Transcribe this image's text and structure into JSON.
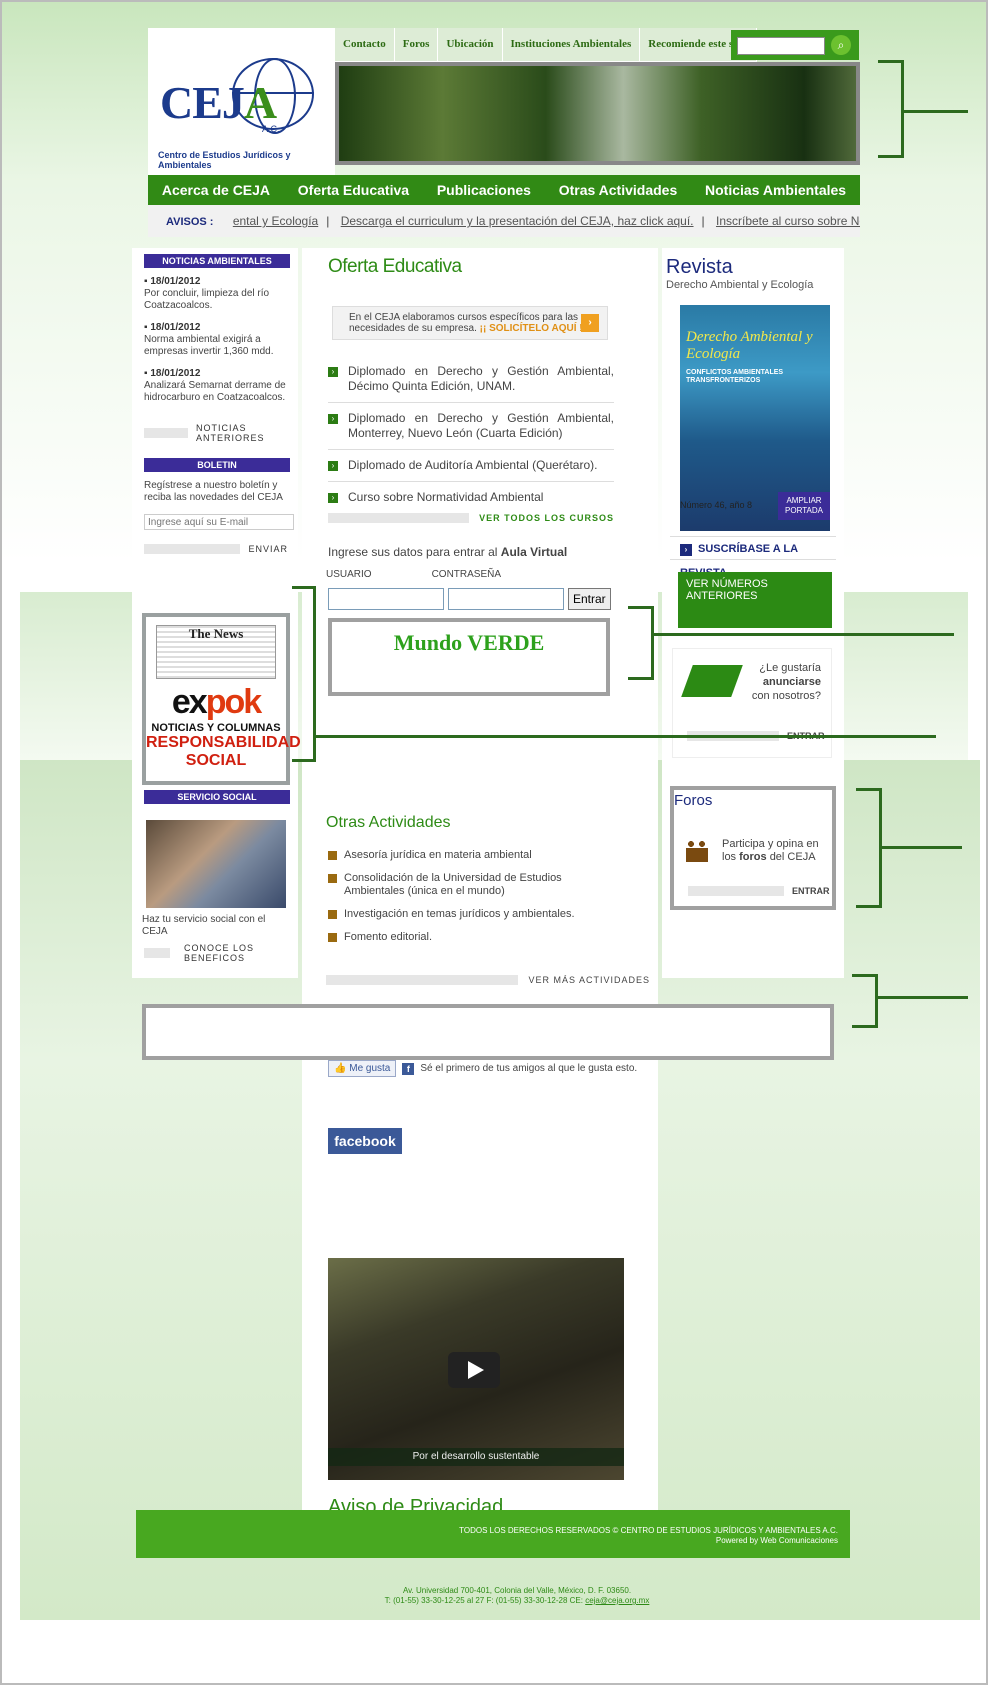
{
  "logo": {
    "name": "CEJA",
    "ac": "A.C.",
    "tagline": "Centro de Estudios Jurídicos y Ambientales"
  },
  "topnav": [
    "Contacto",
    "Foros",
    "Ubicación",
    "Instituciones Ambientales",
    "Recomiende este sitio"
  ],
  "search": {
    "value": "",
    "icon": "search-icon"
  },
  "mainnav": [
    "Acerca de CEJA",
    "Oferta Educativa",
    "Publicaciones",
    "Otras Actividades",
    "Noticias Ambientales"
  ],
  "avisos": {
    "label": "AVISOS :",
    "items": [
      "ental y Ecología",
      "Descarga el curriculum y la presentación del CEJA, haz click aquí.",
      "Inscríbete al curso sobre Norn"
    ],
    "sep": "|"
  },
  "left": {
    "news_header": "NOTICIAS AMBIENTALES",
    "news": [
      {
        "date": "18/01/2012",
        "text": "Por concluir, limpieza del río Coatzacoalcos."
      },
      {
        "date": "18/01/2012",
        "text": "Norma ambiental exigirá a empresas invertir 1,360 mdd."
      },
      {
        "date": "18/01/2012",
        "text": "Analizará Semarnat derrame de hidrocarburo en Coatzacoalcos."
      }
    ],
    "news_more": "NOTICIAS ANTERIORES",
    "boletin_header": "BOLETIN",
    "boletin_text": "Regístrese a nuestro boletín y reciba las novedades del CEJA",
    "email_placeholder": "Ingrese aquí su E-mail",
    "enviar": "ENVIAR",
    "expok": {
      "paper": "The News",
      "brand_a": "ex",
      "brand_b": "pok",
      "line1": "NOTICIAS Y COLUMNAS",
      "line2": "RESPONSABILIDAD SOCIAL"
    },
    "social_header": "SERVICIO SOCIAL",
    "social_text": "Haz tu servicio social con el CEJA",
    "social_more": "CONOCE LOS BENEFICOS"
  },
  "center": {
    "title": "Oferta Educativa",
    "promo_text": "En el CEJA elaboramos cursos específicos para las necesidades de su empresa.",
    "promo_cta": "¡¡ SOLICÍTELO AQUÍ !!",
    "courses": [
      "Diplomado en Derecho y Gestión Ambiental, Décimo Quinta Edición, UNAM.",
      "Diplomado en Derecho y Gestión Ambiental, Monterrey, Nuevo León (Cuarta Edición)",
      "Diplomado de Auditoría Ambiental (Querétaro).",
      "Curso sobre Normatividad Ambiental"
    ],
    "ver_cursos": "VER TODOS LOS CURSOS",
    "aula_text": "Ingrese sus datos para entrar al",
    "aula_bold": "Aula Virtual",
    "usuario": "USUARIO",
    "contrasena": "CONTRASEÑA",
    "entrar_btn": "Entrar",
    "mundo": "Mundo VERDE",
    "otras_title": "Otras Actividades",
    "activities": [
      "Asesoría jurídica en materia ambiental",
      "Consolidación de la Universidad de Estudios Ambientales (única en el mundo)",
      "Investigación en temas jurídicos y ambientales.",
      "Fomento editorial."
    ],
    "ver_mas": "VER MÁS ACTIVIDADES",
    "like_btn": "Me gusta",
    "like_text": "Sé el primero de tus amigos al que le gusta esto.",
    "facebook": "facebook",
    "video_caption": "Por el desarrollo sustentable",
    "privacy": "Aviso de Privacidad",
    "address1": "Av. Universidad 700-401, Colonia del Valle, México, D. F. 03650.",
    "address2": "T: (01-55) 33-30-12-25 al 27 F: (01-55) 33-30-12-28 CE:",
    "email": "ceja@ceja.org.mx"
  },
  "right": {
    "title": "Revista",
    "subtitle": "Derecho Ambiental y Ecología",
    "cover_title": "Derecho Ambiental y Ecología",
    "cover_topic": "CONFLICTOS AMBIENTALES TRANSFRONTERIZOS",
    "issue": "Número 46, año 8",
    "ampliar": "AMPLIAR PORTADA",
    "suscribase": "SUSCRÍBASE A LA REVISTA",
    "ver_numeros": "VER NÚMEROS ANTERIORES",
    "anunciarse_1": "¿Le gustaría",
    "anunciarse_2": "anunciarse",
    "anunciarse_3": "con nosotros?",
    "entrar": "ENTRAR",
    "foros_title": "Foros",
    "foros_text_1": "Participa y opina en los",
    "foros_text_bold": "foros",
    "foros_text_2": "del CEJA",
    "foros_entrar": "ENTRAR"
  },
  "footer": {
    "line1": "TODOS LOS DERECHOS RESERVADOS © CENTRO DE ESTUDIOS JURÍDICOS Y AMBIENTALES A.C.",
    "line2": "Powered by Web Comunicaciones"
  },
  "colors": {
    "green": "#318a15",
    "navy": "#1c2a7c",
    "purple": "#3b2c98",
    "annotation": "#2c6a1e"
  }
}
